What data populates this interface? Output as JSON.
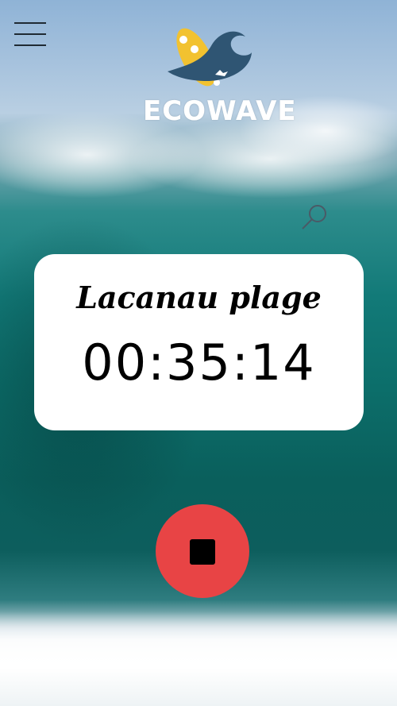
{
  "header": {
    "menu_icon": "hamburger-menu-icon",
    "logo_text": "ECOWAVE"
  },
  "search": {
    "icon": "search-icon"
  },
  "session": {
    "spot_name": "Lacanau plage",
    "elapsed": "00:35:14"
  },
  "controls": {
    "stop_icon": "stop-icon"
  },
  "colors": {
    "stop_button": "#e84445",
    "card": "#ffffff",
    "logo_surfboard": "#f2c230",
    "logo_wave": "#2f5573"
  }
}
